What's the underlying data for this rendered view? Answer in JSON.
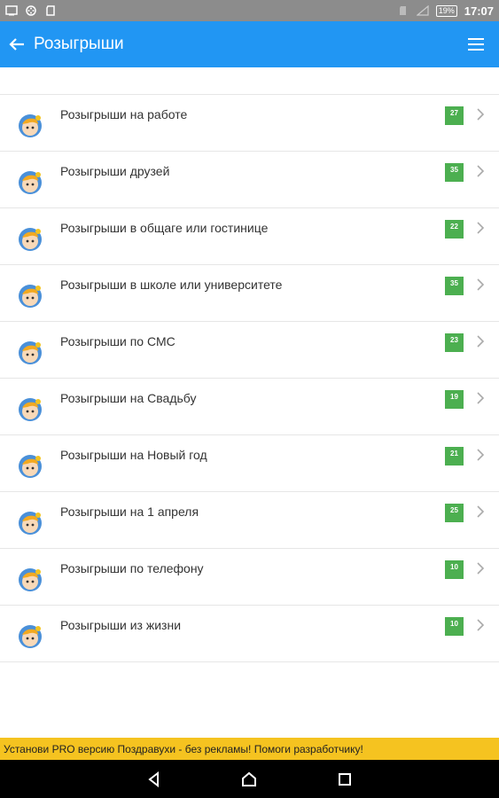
{
  "status_bar": {
    "battery": "19%",
    "time": "17:07"
  },
  "app_bar": {
    "back_icon": "arrow-left-icon",
    "title": "Розыгрыши",
    "menu_icon": "hamburger-menu-icon"
  },
  "list": {
    "items": [
      {
        "label": "Розыгрыши на работе",
        "count": "27"
      },
      {
        "label": "Розыгрыши друзей",
        "count": "35"
      },
      {
        "label": "Розыгрыши в общаге или гостинице",
        "count": "22"
      },
      {
        "label": "Розыгрыши в школе или университете",
        "count": "35"
      },
      {
        "label": "Розыгрыши по СМС",
        "count": "23"
      },
      {
        "label": "Розыгрыши на Свадьбу",
        "count": "19"
      },
      {
        "label": "Розыгрыши на Новый год",
        "count": "21"
      },
      {
        "label": "Розыгрыши на 1 апреля",
        "count": "25"
      },
      {
        "label": "Розыгрыши по телефону",
        "count": "10"
      },
      {
        "label": "Розыгрыши из жизни",
        "count": "10"
      }
    ]
  },
  "promo": {
    "text": "Установи PRO версию Поздравухи - без рекламы! Помоги разработчику!"
  },
  "colors": {
    "app_bar": "#2196f3",
    "badge": "#4caf50",
    "promo": "#f5c320"
  }
}
